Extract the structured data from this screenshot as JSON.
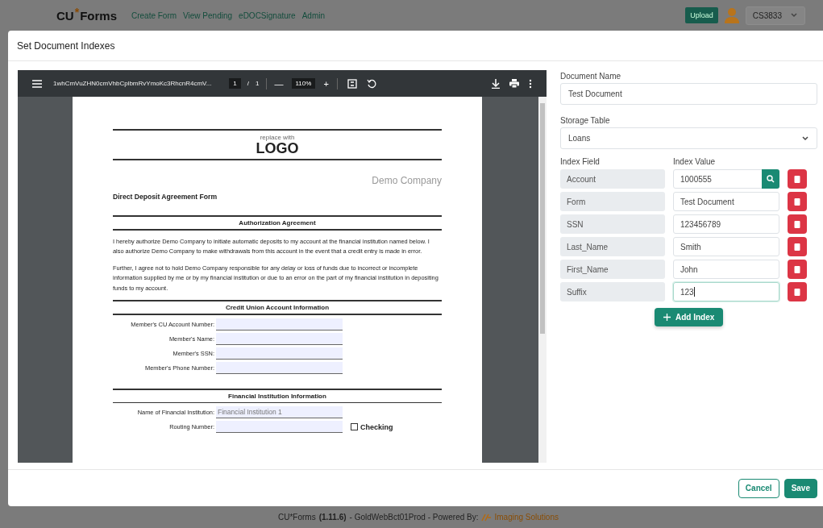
{
  "app_header": {
    "logo": {
      "part_1": "CU",
      "part_2": "*",
      "part_3": "Forms"
    },
    "nav": [
      {
        "label": "Create Form"
      },
      {
        "label": "View Pending"
      },
      {
        "label": "eDOCSignature"
      },
      {
        "label": "Admin"
      }
    ],
    "upload_button": "Upload",
    "user": "CS3833"
  },
  "modal": {
    "title": "Set Document Indexes",
    "pdf_viewer": {
      "filename": "1whCmVuZHN0cmVhbCplbmRvYmoKc3RhcnR4cmV...",
      "page": "1",
      "page_separator": "/",
      "total_pages": "1",
      "zoom_out": "—",
      "zoom": "110%",
      "zoom_in": "+",
      "document": {
        "logo_small": "replace with",
        "logo_big": "LOGO",
        "company": "Demo Company",
        "title": "Direct Deposit Agreement Form",
        "sections": [
          {
            "heading": "Authorization Agreement",
            "paragraphs": [
              "I hereby authorize Demo Company to initiate automatic deposits to my account at the financial institution named below. I also authorize Demo Company to make withdrawals from this account in the event that a credit entry is made in error.",
              "Further, I agree not to hold Demo Company responsible for any delay or loss of funds due to incorrect or incomplete information supplied by me or by my financial institution or due to an error on the part of my financial institution in depositing funds to my account."
            ]
          },
          {
            "heading": "Credit Union Account Information",
            "fields": [
              {
                "label": "Member's CU Account Number:"
              },
              {
                "label": "Member's Name:"
              },
              {
                "label": "Member's SSN:"
              },
              {
                "label": "Member's Phone Number:"
              }
            ]
          },
          {
            "heading": "Financial Institution Information",
            "fields": [
              {
                "label": "Name of Financial Institution:",
                "value": "Financial Institution 1"
              },
              {
                "label": "Routing Number:",
                "checkbox": {
                  "label": "Checking",
                  "checked": false
                }
              }
            ]
          }
        ]
      }
    },
    "form": {
      "document_name_label": "Document Name",
      "document_name": "Test Document",
      "storage_table_label": "Storage Table",
      "storage_table": "Loans",
      "index_field_header": "Index Field",
      "index_value_header": "Index Value",
      "indexes": [
        {
          "field": "Account",
          "value": "1000555",
          "lookup": true,
          "focused": false
        },
        {
          "field": "Form",
          "value": "Test Document",
          "lookup": false,
          "focused": false
        },
        {
          "field": "SSN",
          "value": "123456789",
          "lookup": false,
          "focused": false
        },
        {
          "field": "Last_Name",
          "value": "Smith",
          "lookup": false,
          "focused": false
        },
        {
          "field": "First_Name",
          "value": "John",
          "lookup": false,
          "focused": false
        },
        {
          "field": "Suffix",
          "value": "123",
          "lookup": false,
          "focused": true
        }
      ],
      "add_button": "Add Index"
    },
    "buttons": [
      {
        "label": "Cancel",
        "kind": "outline"
      },
      {
        "label": "Save",
        "kind": "primary"
      }
    ]
  },
  "footer": {
    "app": "CU*Forms",
    "version": "(1.11.6)",
    "text": "- GoldWebBct01Prod - Powered By:",
    "vendor": "Imaging Solutions"
  }
}
